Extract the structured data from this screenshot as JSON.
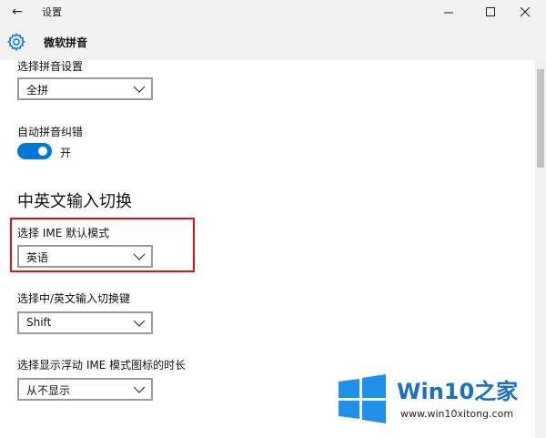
{
  "window": {
    "back_glyph": "←",
    "title": "设置",
    "minimize_glyph": "—",
    "maximize_glyph": "□",
    "close_glyph": "✕"
  },
  "header": {
    "icon": "gear-icon",
    "title": "微软拼音"
  },
  "settings": {
    "pinyin_setting": {
      "label": "选择拼音设置",
      "value": "全拼"
    },
    "autocorrect": {
      "label": "自动拼音纠错",
      "state_text": "开",
      "on": true
    },
    "section_title": "中英文输入切换",
    "ime_default_mode": {
      "label": "选择 IME 默认模式",
      "value": "英语"
    },
    "switch_key": {
      "label": "选择中/英文输入切换键",
      "value": "Shift"
    },
    "float_icon_duration": {
      "label": "选择显示浮动 IME 模式图标的时长",
      "value": "从不显示"
    }
  },
  "watermark": {
    "brand": "Win10",
    "brand_zh": "之家",
    "url": "www.win10xitong.com"
  },
  "colors": {
    "accent": "#0078d7",
    "highlight": "#e0101a"
  }
}
